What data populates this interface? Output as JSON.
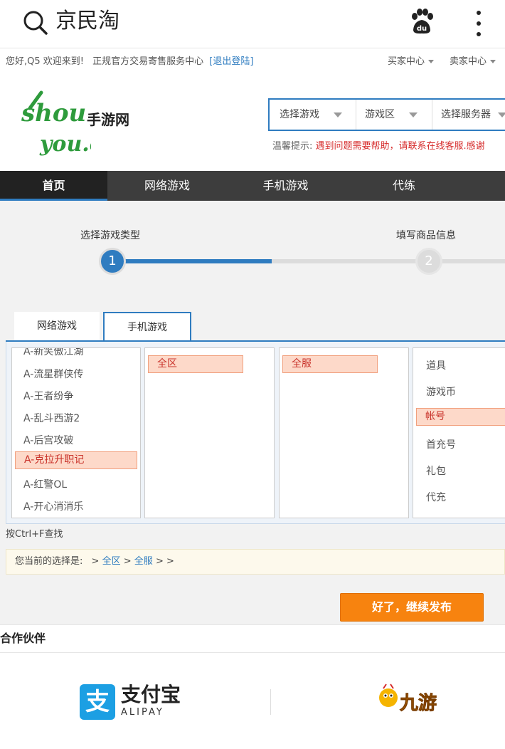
{
  "browser": {
    "address_text": "京民淘"
  },
  "topbar": {
    "greeting": "您好,Q5 欢迎来到!",
    "service": "正规官方交易寄售服务中心",
    "logout": "[退出登陆]",
    "buyer_center": "买家中心",
    "seller_center": "卖家中心"
  },
  "logo": {
    "cn": "手游网",
    "line1": "shou",
    "line2": "you.com"
  },
  "selectors": {
    "game": "选择游戏",
    "area": "游戏区",
    "server": "选择服务器"
  },
  "tip": {
    "label": "温馨提示:",
    "text": "遇到问题需要帮助，请联系在线客服.感谢"
  },
  "nav": [
    {
      "label": "首页",
      "active": true
    },
    {
      "label": "网络游戏",
      "active": false
    },
    {
      "label": "手机游戏",
      "active": false
    },
    {
      "label": "代练",
      "active": false
    }
  ],
  "steps": [
    {
      "num": "1",
      "label": "选择游戏类型"
    },
    {
      "num": "2",
      "label": "填写商品信息"
    }
  ],
  "tabs": [
    {
      "label": "网络游戏",
      "active": false
    },
    {
      "label": "手机游戏",
      "active": true
    }
  ],
  "games": [
    {
      "label": "A-新笑傲江湖",
      "selected": false
    },
    {
      "label": "A-流星群侠传",
      "selected": false
    },
    {
      "label": "A-王者纷争",
      "selected": false
    },
    {
      "label": "A-乱斗西游2",
      "selected": false
    },
    {
      "label": "A-后宫攻破",
      "selected": false
    },
    {
      "label": "A-克拉升职记",
      "selected": true
    },
    {
      "label": "A-红警OL",
      "selected": false
    },
    {
      "label": "A-开心消消乐",
      "selected": false
    }
  ],
  "area_option": "全区",
  "server_option": "全服",
  "types": [
    {
      "label": "道具",
      "selected": false
    },
    {
      "label": "游戏币",
      "selected": false
    },
    {
      "label": "帐号",
      "selected": true
    },
    {
      "label": "首充号",
      "selected": false
    },
    {
      "label": "礼包",
      "selected": false
    },
    {
      "label": "代充",
      "selected": false
    }
  ],
  "hint": "按Ctrl+F查找",
  "selection": {
    "prefix": "您当前的选择是:",
    "sep1": ">",
    "area": "全区",
    "sep2": ">",
    "server": "全服",
    "tail": "> >"
  },
  "continue_button": "好了，继续发布",
  "partners": {
    "title": "合作伙伴",
    "alipay_cn": "支付宝",
    "alipay_en": "ALIPAY",
    "alipay_icon": "支",
    "jiuyou": "九游"
  },
  "colors": {
    "accent": "#2f7cc0",
    "orange": "#f7830f",
    "red": "#d62b2b",
    "nav_bg": "#3d3d3d"
  }
}
